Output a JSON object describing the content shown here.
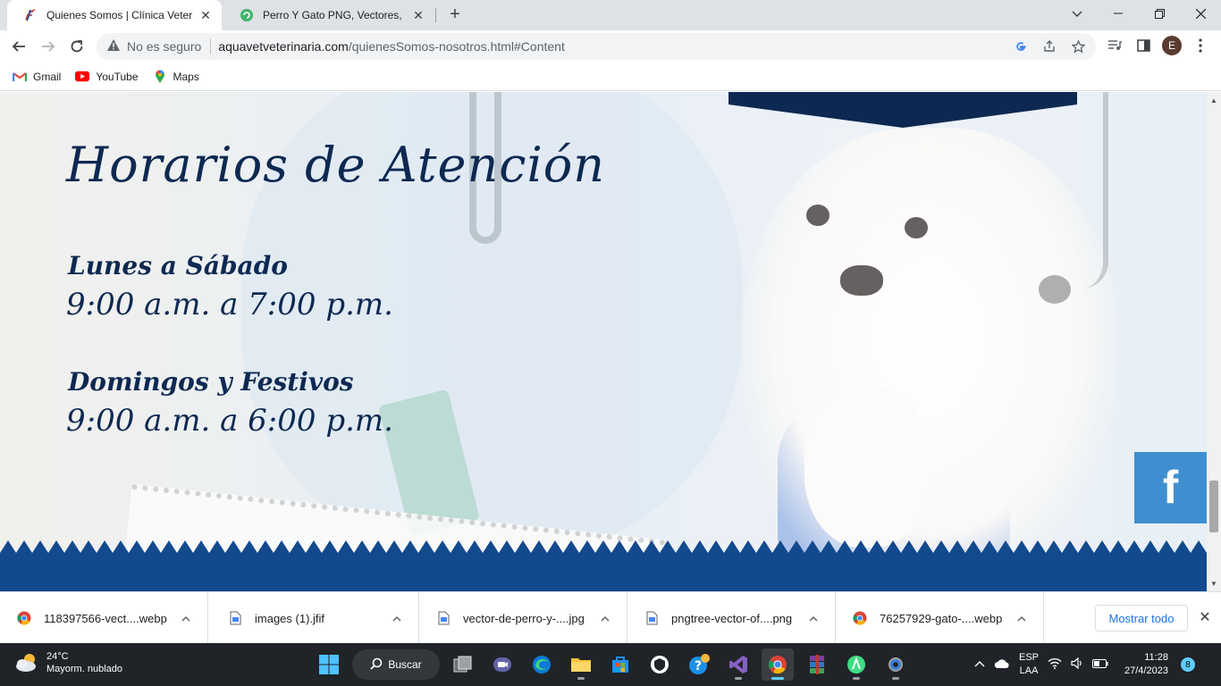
{
  "browser": {
    "tabs": [
      {
        "title": "Quienes Somos | Clínica Veterina",
        "active": true,
        "favicon": "clinic-logo-icon"
      },
      {
        "title": "Perro Y Gato PNG, Vectores, PSD",
        "active": false,
        "favicon": "pngtree-icon"
      }
    ],
    "address": {
      "security_label": "No es seguro",
      "domain": "aquavetveterinaria.com",
      "path": "/quienesSomos-nosotros.html#Content"
    },
    "profile_initial": "E",
    "bookmarks": [
      {
        "label": "Gmail",
        "icon": "gmail-icon"
      },
      {
        "label": "YouTube",
        "icon": "youtube-icon"
      },
      {
        "label": "Maps",
        "icon": "maps-icon"
      }
    ]
  },
  "page": {
    "heading": "Horarios de Atención",
    "schedule": [
      {
        "days": "Lunes a Sábado",
        "hours": "9:00 a.m. a 7:00 p.m."
      },
      {
        "days": "Domingos y Festivos",
        "hours": "9:00 a.m. a 6:00 p.m."
      }
    ],
    "facebook_label": "f",
    "colors": {
      "navy": "#0d2952",
      "wave_blue": "#134a8e",
      "facebook_blue": "#3f8fd0"
    }
  },
  "downloads": {
    "items": [
      {
        "name": "118397566-vect....webp",
        "icon": "chrome-icon"
      },
      {
        "name": "images (1).jfif",
        "icon": "file-icon"
      },
      {
        "name": "vector-de-perro-y-....jpg",
        "icon": "file-icon"
      },
      {
        "name": "pngtree-vector-of....png",
        "icon": "file-icon"
      },
      {
        "name": "76257929-gato-....webp",
        "icon": "chrome-icon"
      }
    ],
    "show_all_label": "Mostrar todo"
  },
  "taskbar": {
    "weather": {
      "temp": "24°C",
      "condition": "Mayorm. nublado"
    },
    "search_label": "Buscar",
    "language": {
      "line1": "ESP",
      "line2": "LAA"
    },
    "time": "11:28",
    "date": "27/4/2023",
    "notification_count": "8"
  }
}
